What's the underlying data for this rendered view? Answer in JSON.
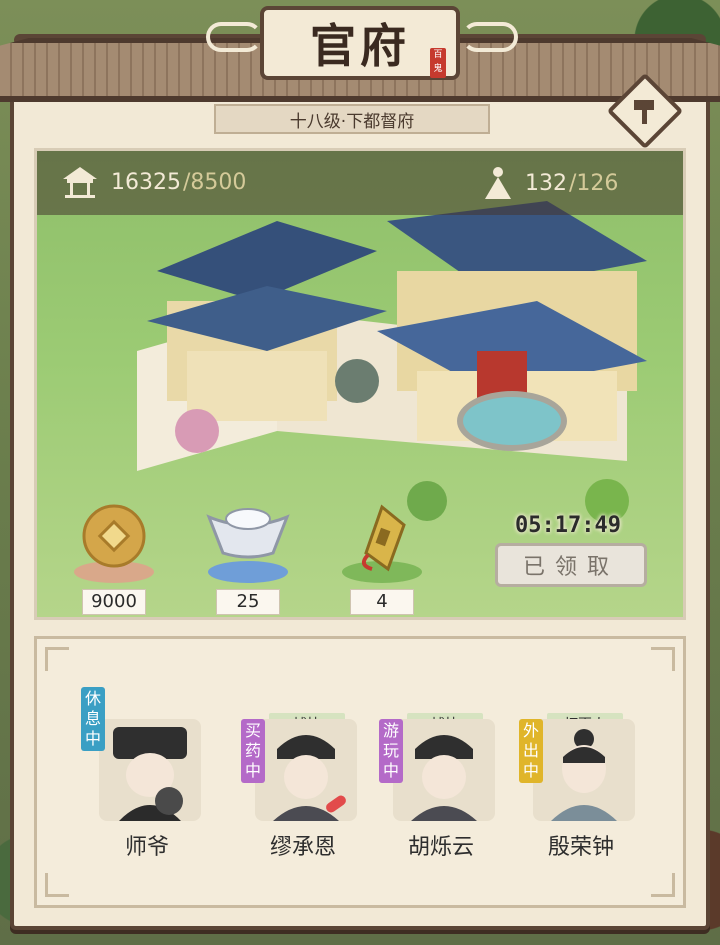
{
  "header": {
    "title": "官府",
    "seal_text": "百鬼",
    "rank": "十八级·下都督府"
  },
  "stats": {
    "building_value": "16325",
    "building_max": "/8500",
    "people_value": "132",
    "people_max": "/126"
  },
  "scene": {
    "timer": "05:17:49",
    "claim_label": "已领取"
  },
  "rewards": [
    {
      "icon": "copper-coin-icon",
      "amount": "9000"
    },
    {
      "icon": "silver-ingot-icon",
      "amount": "25"
    },
    {
      "icon": "official-token-icon",
      "amount": "4"
    }
  ],
  "staff": [
    {
      "name": "师爷",
      "status": "休息中",
      "status_color": "#3a9fc4",
      "role": ""
    },
    {
      "name": "缪承恩",
      "status": "买药中",
      "status_color": "#b46ac8",
      "role": "捕快"
    },
    {
      "name": "胡烁云",
      "status": "游玩中",
      "status_color": "#b46ac8",
      "role": "捕快"
    },
    {
      "name": "殷荣钟",
      "status": "外出中",
      "status_color": "#e0b52a",
      "role": "打更人"
    }
  ],
  "colors": {
    "frame": "#5b4536",
    "parchment": "#f2e9d6",
    "claim_disabled": "#e9e4db"
  }
}
